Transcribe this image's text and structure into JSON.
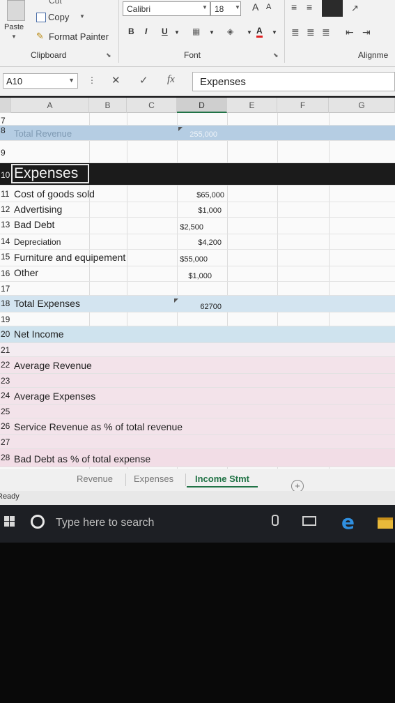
{
  "ribbon": {
    "clipboard": {
      "paste_label": "Paste",
      "cut_label": "Cut",
      "copy_label": "Copy",
      "format_painter_label": "Format Painter",
      "group_label": "Clipboard"
    },
    "font": {
      "font_name": "Calibri",
      "font_size": "18",
      "grow_label": "A",
      "shrink_label": "A",
      "bold_label": "B",
      "italic_label": "I",
      "underline_label": "U",
      "font_color_label": "A",
      "group_label": "Font"
    },
    "alignment": {
      "group_label": "Alignme"
    }
  },
  "formula_bar": {
    "name_box": "A10",
    "cancel_glyph": "✕",
    "enter_glyph": "✓",
    "fx_glyph": "fx",
    "content": "Expenses"
  },
  "columns": [
    {
      "id": "A",
      "label": "A"
    },
    {
      "id": "B",
      "label": "B"
    },
    {
      "id": "C",
      "label": "C"
    },
    {
      "id": "D",
      "label": "D"
    },
    {
      "id": "E",
      "label": "E"
    },
    {
      "id": "F",
      "label": "F"
    },
    {
      "id": "G",
      "label": "G"
    }
  ],
  "rows": [
    {
      "num": "7",
      "label": "",
      "value": ""
    },
    {
      "num": "8",
      "label": "Total Revenue",
      "value": "255,000"
    },
    {
      "num": "9",
      "label": "",
      "value": ""
    },
    {
      "num": "10",
      "label": "Expenses",
      "value": ""
    },
    {
      "num": "11",
      "label": "Cost of goods sold",
      "value": "$65,000"
    },
    {
      "num": "12",
      "label": "Advertising",
      "value": "$1,000"
    },
    {
      "num": "13",
      "label": "Bad Debt",
      "value": "$2,500"
    },
    {
      "num": "14",
      "label": "Depreciation",
      "value": "$4,200"
    },
    {
      "num": "15",
      "label": "Furniture and equipement",
      "value": "$55,000"
    },
    {
      "num": "16",
      "label": "Other",
      "value": "$1,000"
    },
    {
      "num": "17",
      "label": "",
      "value": ""
    },
    {
      "num": "18",
      "label": "Total Expenses",
      "value": "62700"
    },
    {
      "num": "19",
      "label": "",
      "value": ""
    },
    {
      "num": "20",
      "label": "Net Income",
      "value": ""
    },
    {
      "num": "21",
      "label": "",
      "value": ""
    },
    {
      "num": "22",
      "label": "Average Revenue",
      "value": ""
    },
    {
      "num": "23",
      "label": "",
      "value": ""
    },
    {
      "num": "24",
      "label": "Average Expenses",
      "value": ""
    },
    {
      "num": "25",
      "label": "",
      "value": ""
    },
    {
      "num": "26",
      "label": "Service Revenue as % of total revenue",
      "value": ""
    },
    {
      "num": "27",
      "label": "",
      "value": ""
    },
    {
      "num": "28",
      "label": "Bad Debt as % of total expense",
      "value": ""
    }
  ],
  "sheet_tabs": [
    {
      "label": "Revenue",
      "active": false
    },
    {
      "label": "Expenses",
      "active": false
    },
    {
      "label": "Income Stmt",
      "active": true
    }
  ],
  "add_sheet_glyph": "+",
  "status": "Ready",
  "taskbar": {
    "search_placeholder": "Type here to search"
  },
  "colors": {
    "accent": "#217346",
    "band_blue": "#b5cde3",
    "band_light": "#d3e4f0",
    "band_pink": "#f3e3ea"
  }
}
